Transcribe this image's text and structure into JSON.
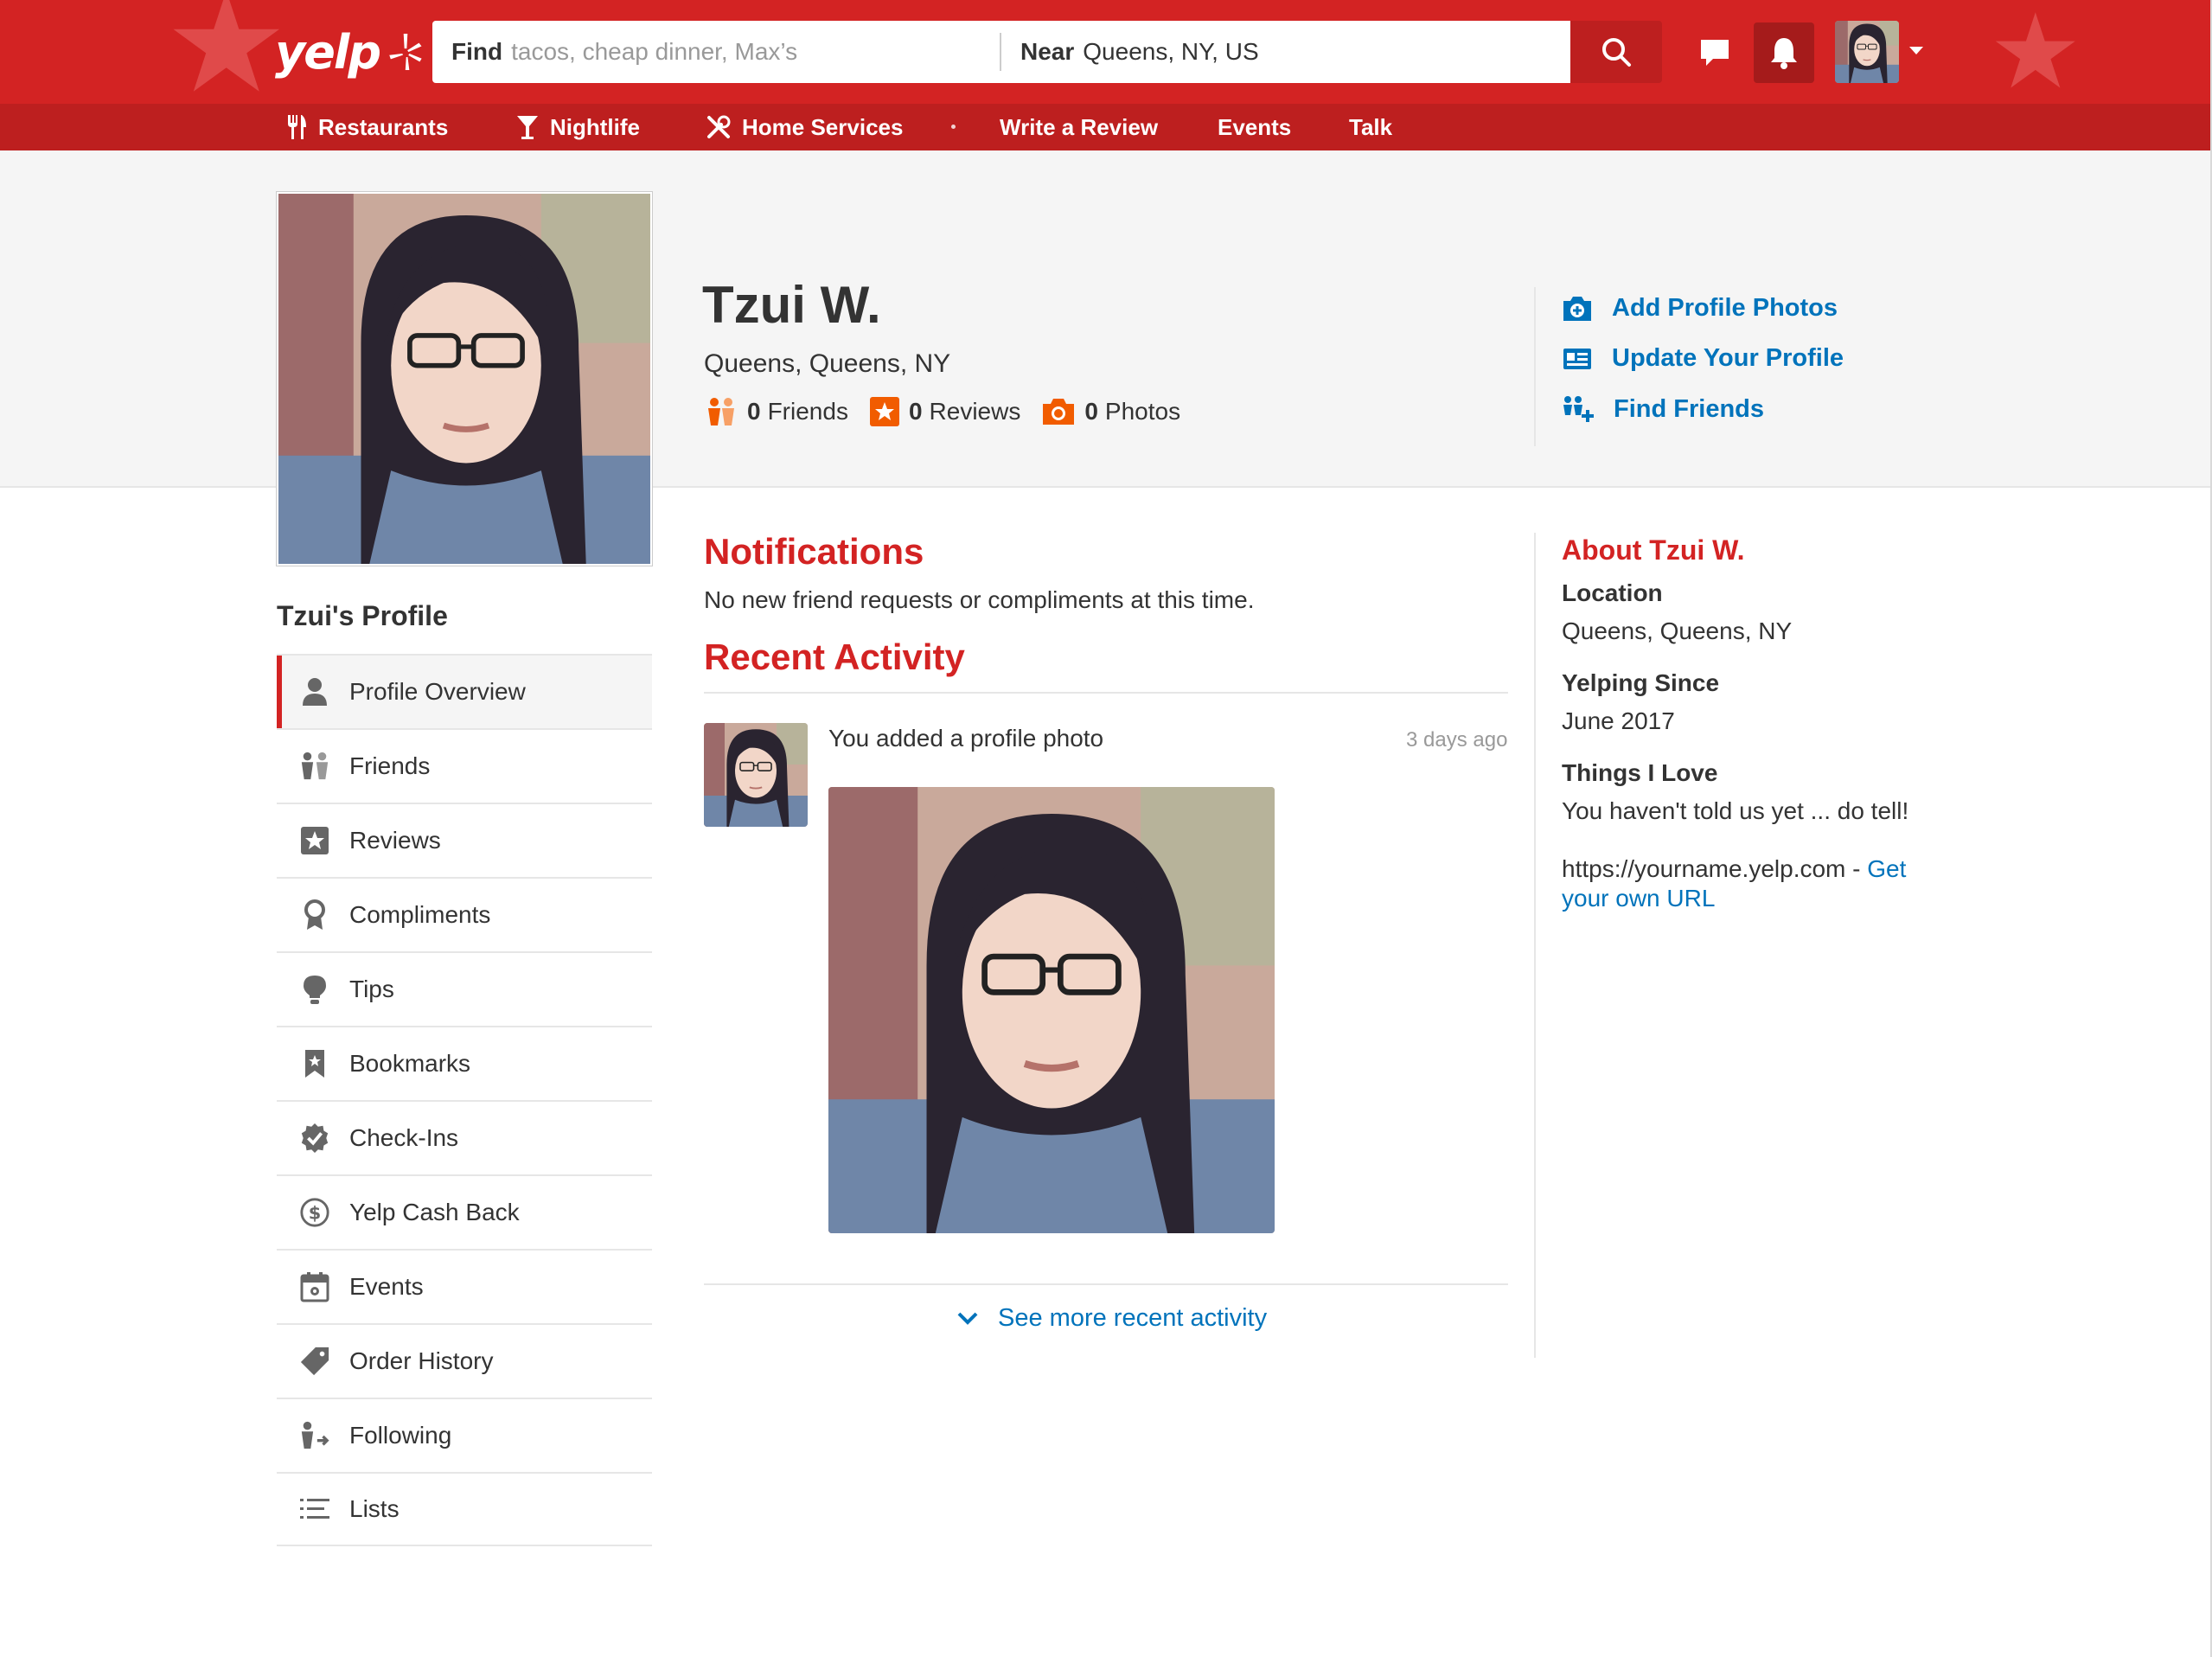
{
  "header": {
    "logo_text": "yelp",
    "search": {
      "find_label": "Find",
      "find_placeholder": "tacos, cheap dinner, Max’s",
      "near_label": "Near",
      "near_value": "Queens, NY, US"
    },
    "icons": [
      "search-icon",
      "message-icon",
      "bell-icon"
    ]
  },
  "nav": {
    "items": [
      {
        "label": "Restaurants",
        "icon": "fork-knife-icon"
      },
      {
        "label": "Nightlife",
        "icon": "cocktail-icon"
      },
      {
        "label": "Home Services",
        "icon": "tools-icon"
      },
      {
        "label": "Write a Review"
      },
      {
        "label": "Events"
      },
      {
        "label": "Talk"
      }
    ]
  },
  "profile": {
    "name": "Tzui W.",
    "location": "Queens, Queens, NY",
    "stats": [
      {
        "count": "0",
        "label": "Friends"
      },
      {
        "count": "0",
        "label": "Reviews"
      },
      {
        "count": "0",
        "label": "Photos"
      }
    ],
    "actions": [
      {
        "label": "Add Profile Photos",
        "icon": "camera-plus-icon"
      },
      {
        "label": "Update Your Profile",
        "icon": "profile-card-icon"
      },
      {
        "label": "Find Friends",
        "icon": "add-friend-icon"
      }
    ]
  },
  "sidebar": {
    "title": "Tzui's Profile",
    "items": [
      {
        "label": "Profile Overview",
        "icon": "person-icon",
        "active": true
      },
      {
        "label": "Friends",
        "icon": "friends-icon"
      },
      {
        "label": "Reviews",
        "icon": "star-icon"
      },
      {
        "label": "Compliments",
        "icon": "ribbon-icon"
      },
      {
        "label": "Tips",
        "icon": "lightbulb-icon"
      },
      {
        "label": "Bookmarks",
        "icon": "bookmark-icon"
      },
      {
        "label": "Check-Ins",
        "icon": "checkin-badge-icon"
      },
      {
        "label": "Yelp Cash Back",
        "icon": "dollar-icon"
      },
      {
        "label": "Events",
        "icon": "calendar-icon"
      },
      {
        "label": "Order History",
        "icon": "tag-icon"
      },
      {
        "label": "Following",
        "icon": "following-icon"
      },
      {
        "label": "Lists",
        "icon": "list-icon"
      }
    ]
  },
  "main": {
    "notifications_title": "Notifications",
    "notifications_text": "No new friend requests or compliments at this time.",
    "recent_title": "Recent Activity",
    "activity": {
      "text": "You added a profile photo",
      "time": "3 days ago"
    },
    "see_more": "See more recent activity"
  },
  "about": {
    "title": "About Tzui W.",
    "location_label": "Location",
    "location_value": "Queens, Queens, NY",
    "since_label": "Yelping Since",
    "since_value": "June 2017",
    "love_label": "Things I Love",
    "love_value": "You haven't told us yet ... do tell!",
    "url_text": "https://yourname.yelp.com - ",
    "url_link": "Get your own URL"
  },
  "colors": {
    "brand_red": "#d32323",
    "nav_red": "#bd1f1f",
    "link_blue": "#0073bb",
    "stat_orange": "#f15c00"
  }
}
